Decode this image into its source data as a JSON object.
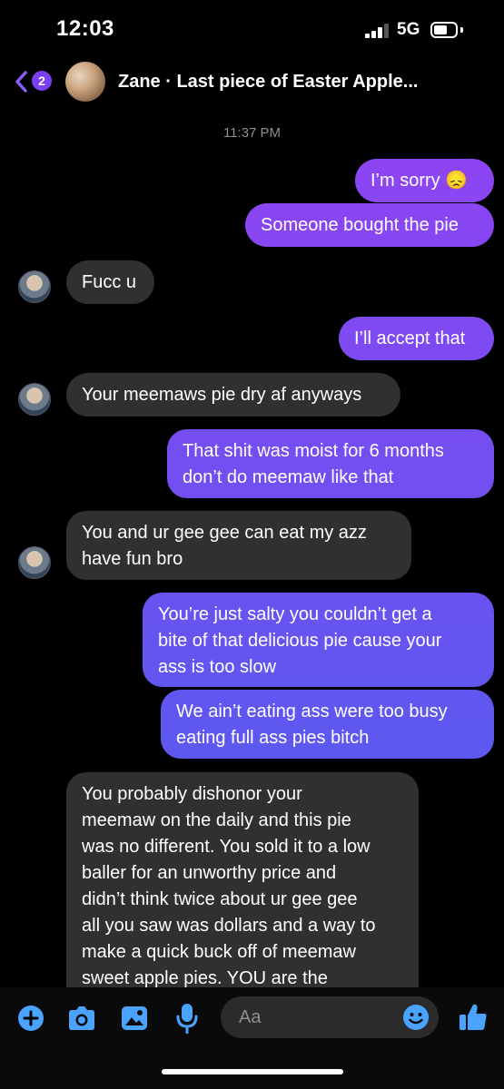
{
  "status_bar": {
    "time": "12:03",
    "network": "5G"
  },
  "header": {
    "unread_count": "2",
    "title": "Zane · Last piece of Easter Apple..."
  },
  "timestamp": "11:37 PM",
  "messages": [
    {
      "id": "m1",
      "direction": "outgoing",
      "lines": [
        "I’m sorry 😞"
      ]
    },
    {
      "id": "m2",
      "direction": "outgoing",
      "lines": [
        "Someone bought the pie"
      ]
    },
    {
      "id": "m3",
      "direction": "incoming",
      "lines": [
        "Fucc u"
      ]
    },
    {
      "id": "m4",
      "direction": "outgoing",
      "lines": [
        "I’ll accept that"
      ]
    },
    {
      "id": "m5",
      "direction": "incoming",
      "lines": [
        "Your meemaws pie dry af anyways"
      ]
    },
    {
      "id": "m6",
      "direction": "outgoing",
      "lines": [
        "That shit was moist for 6 months",
        "don’t do meemaw like that"
      ]
    },
    {
      "id": "m7",
      "direction": "incoming",
      "lines": [
        "You and ur gee gee can eat my azz",
        "have fun bro"
      ]
    },
    {
      "id": "m8",
      "direction": "outgoing",
      "lines": [
        "You’re just salty you couldn’t get a",
        "bite of that delicious pie cause your",
        "ass is too slow"
      ]
    },
    {
      "id": "m9",
      "direction": "outgoing",
      "lines": [
        "We ain’t eating ass were too busy",
        "eating full ass pies bitch"
      ]
    },
    {
      "id": "m10",
      "direction": "incoming",
      "lines": [
        "You probably dishonor your",
        "meemaw on the daily and this pie",
        "was no different. You sold it to a low",
        "baller for an unworthy price and",
        "didn’t think twice about ur gee gee",
        "all you saw was dollars and a way to",
        "make a quick buck off of meemaw",
        "sweet apple pies. YOU are the"
      ]
    }
  ],
  "composer": {
    "placeholder": "Aa"
  },
  "colors": {
    "bubble_top": "#9a3ff2",
    "bubble_bottom": "#4f5df0",
    "incoming_bubble": "#303030",
    "accent": "#4aa3ff",
    "badge": "#7b3ff2"
  },
  "icons": [
    "chevron-left-icon",
    "plus-icon",
    "camera-icon",
    "gallery-icon",
    "microphone-icon",
    "emoji-icon",
    "thumbs-up-icon"
  ]
}
